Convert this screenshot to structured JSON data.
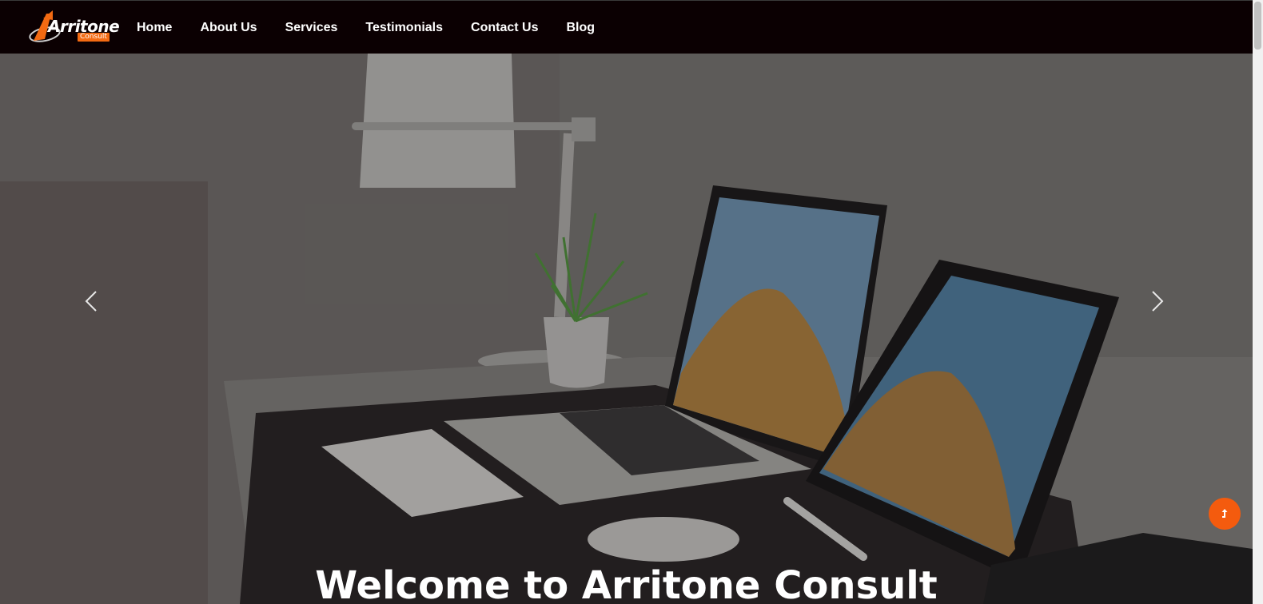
{
  "brand": {
    "name": "Arritone",
    "sub": "Consult",
    "accent_color": "#f36a12"
  },
  "nav": {
    "items": [
      {
        "label": "Home"
      },
      {
        "label": "About Us"
      },
      {
        "label": "Services"
      },
      {
        "label": "Testimonials"
      },
      {
        "label": "Contact Us"
      },
      {
        "label": "Blog"
      }
    ]
  },
  "hero": {
    "title": "Welcome to Arritone Consult",
    "prev_icon": "chevron-left-icon",
    "next_icon": "chevron-right-icon"
  },
  "scroll_top": {
    "icon": "arrow-up-icon",
    "color": "#f45b0e"
  }
}
